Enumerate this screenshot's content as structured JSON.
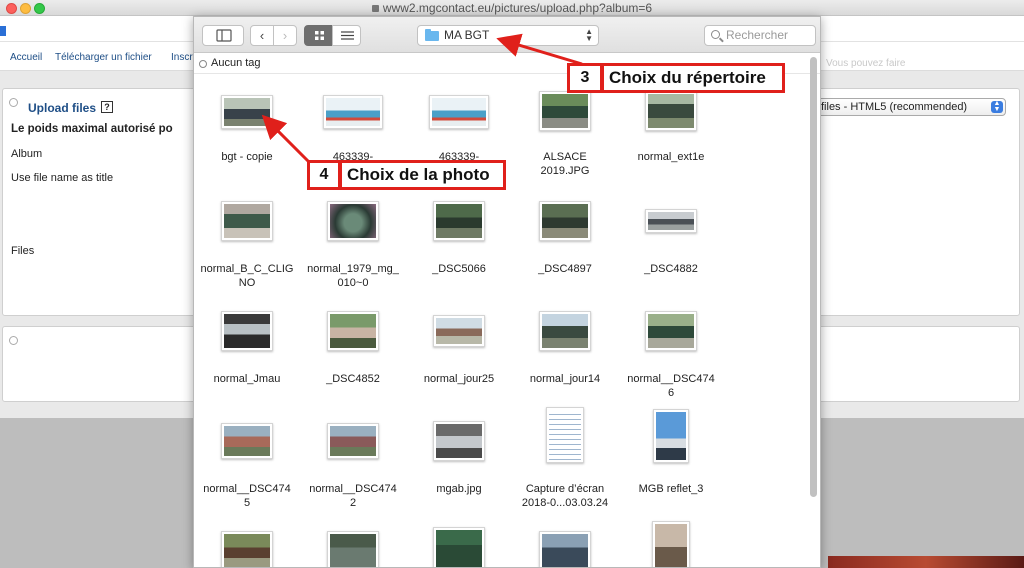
{
  "browser": {
    "url": "www2.mgcontact.eu/pictures/upload.php?album=6"
  },
  "background_page": {
    "menu": [
      "Accueil",
      "Télécharger un fichier",
      "Inscr"
    ],
    "upload_title": "Upload files",
    "help_label": "?",
    "max_weight_label": "Le poids maximal autorisé po",
    "album_label": "Album",
    "use_filename_label": "Use file name as title",
    "files_label": "Files",
    "upload_method_select": "files - HTML5 (recommended)",
    "fade_text": "Vous pouvez faire"
  },
  "dialog": {
    "folder": "MA BGT",
    "search_placeholder": "Rechercher",
    "tag_label": "Aucun tag",
    "files": [
      {
        "name": "bgt - copie",
        "name2": ""
      },
      {
        "name": "463339-",
        "name2": ""
      },
      {
        "name": "463339-",
        "name2": ""
      },
      {
        "name": "ALSACE",
        "name2": "2019.JPG"
      },
      {
        "name": "normal_ext1e",
        "name2": ""
      },
      {
        "name": "normal_B_C_CLIG",
        "name2": "NO"
      },
      {
        "name": "normal_1979_mg_",
        "name2": "010~0"
      },
      {
        "name": "_DSC5066",
        "name2": ""
      },
      {
        "name": "_DSC4897",
        "name2": ""
      },
      {
        "name": "_DSC4882",
        "name2": ""
      },
      {
        "name": "normal_Jmau",
        "name2": ""
      },
      {
        "name": "_DSC4852",
        "name2": ""
      },
      {
        "name": "normal_jour25",
        "name2": ""
      },
      {
        "name": "normal_jour14",
        "name2": ""
      },
      {
        "name": "normal__DSC474",
        "name2": "6"
      },
      {
        "name": "normal__DSC474",
        "name2": "5"
      },
      {
        "name": "normal__DSC474",
        "name2": "2"
      },
      {
        "name": "mgab.jpg",
        "name2": ""
      },
      {
        "name": "Capture d’écran",
        "name2": "2018-0...03.03.24"
      },
      {
        "name": "MGB reflet_3",
        "name2": ""
      }
    ]
  },
  "annotations": {
    "step3": {
      "number": "3",
      "text": "Choix du répertoire"
    },
    "step4": {
      "number": "4",
      "text": "Choix de la photo"
    }
  },
  "colors": {
    "annotation_border": "#e0201b",
    "arrow": "#e0201b",
    "link": "#1e4e86",
    "folder_icon": "#69b7ee"
  }
}
